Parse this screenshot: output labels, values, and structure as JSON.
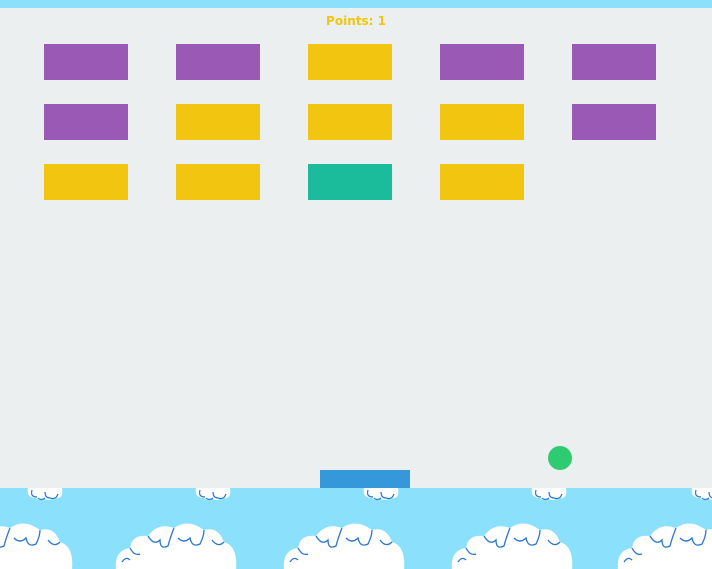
{
  "game": {
    "score_text": "Points: 1",
    "colors": {
      "background": "#ebeff0",
      "sky": "#8be0fb",
      "score": "#f2c511",
      "paddle": "#3498db",
      "ball": "#2ecc71",
      "purple": "#9b59b6",
      "yellow": "#f2c511",
      "teal": "#1abc9c"
    },
    "bricks": [
      {
        "row": 0,
        "col": 0,
        "color": "purple"
      },
      {
        "row": 0,
        "col": 1,
        "color": "purple"
      },
      {
        "row": 0,
        "col": 2,
        "color": "yellow"
      },
      {
        "row": 0,
        "col": 3,
        "color": "purple"
      },
      {
        "row": 0,
        "col": 4,
        "color": "purple"
      },
      {
        "row": 1,
        "col": 0,
        "color": "purple"
      },
      {
        "row": 1,
        "col": 1,
        "color": "yellow"
      },
      {
        "row": 1,
        "col": 2,
        "color": "yellow"
      },
      {
        "row": 1,
        "col": 3,
        "color": "yellow"
      },
      {
        "row": 1,
        "col": 4,
        "color": "purple"
      },
      {
        "row": 2,
        "col": 0,
        "color": "yellow"
      },
      {
        "row": 2,
        "col": 1,
        "color": "yellow"
      },
      {
        "row": 2,
        "col": 2,
        "color": "teal"
      },
      {
        "row": 2,
        "col": 3,
        "color": "yellow"
      }
    ]
  }
}
